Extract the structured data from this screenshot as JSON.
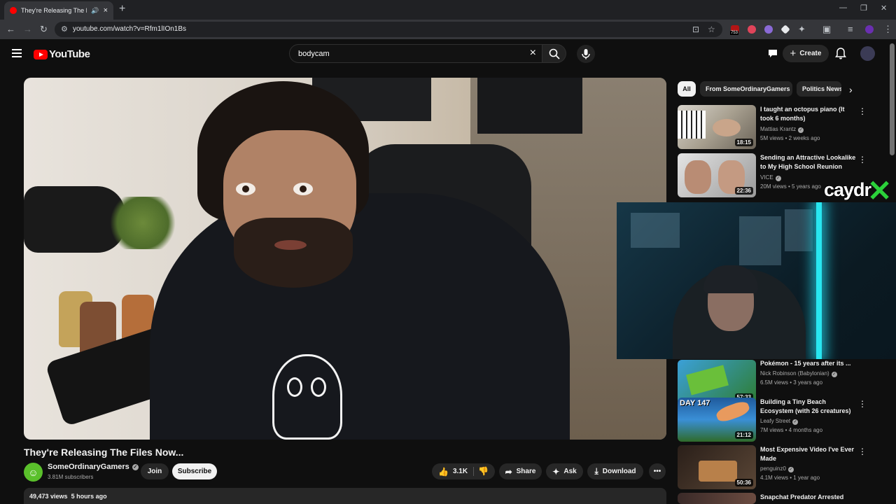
{
  "browser": {
    "tab_title": "They're Releasing The Files",
    "url": "youtube.com/watch?v=Rfm1lIOn1Bs",
    "extension_badge": "753"
  },
  "youtube": {
    "logo_text": "YouTube",
    "search_value": "bodycam",
    "create_label": "Create"
  },
  "video": {
    "title": "They're Releasing The Files Now...",
    "channel": "SomeOrdinaryGamers",
    "subscribers": "3.81M subscribers",
    "join_label": "Join",
    "subscribe_label": "Subscribe",
    "likes": "3.1K",
    "share_label": "Share",
    "ask_label": "Ask",
    "download_label": "Download",
    "views": "49,473 views",
    "age": "5 hours ago"
  },
  "chips": [
    "All",
    "From SomeOrdinaryGamers",
    "Politics News"
  ],
  "recommendations": [
    {
      "title": "I taught an octopus piano (It took 6 months)",
      "channel": "Mattias Krantz",
      "verified": true,
      "meta": "5M views • 2 weeks ago",
      "duration": "18:15"
    },
    {
      "title": "Sending an Attractive Lookalike to My High School Reunion",
      "channel": "VICE",
      "verified": true,
      "meta": "20M views • 5 years ago",
      "duration": "22:36"
    },
    {
      "title": "Pokémon - 15 years after its ...",
      "channel": "Nick Robinson (Babylonian)",
      "verified": true,
      "meta": "6.5M views • 3 years ago",
      "duration": "57:33"
    },
    {
      "title": "Building a Tiny Beach Ecosystem (with 26 creatures)",
      "channel": "Leafy Street",
      "verified": true,
      "meta": "7M views • 4 months ago",
      "duration": "21:12"
    },
    {
      "title": "Most Expensive Video I've Ever Made",
      "channel": "penguinz0",
      "verified": true,
      "meta": "4.1M views • 1 year ago",
      "duration": "50:36"
    },
    {
      "title": "Snapchat Predator Arrested",
      "channel": "",
      "verified": false,
      "meta": "",
      "duration": ""
    }
  ],
  "overlay": {
    "brand_text": "caydr"
  },
  "thumb_text": {
    "day_label": "DAY 147"
  },
  "colors": {
    "youtube_red": "#ff0000",
    "background": "#0f0f0f",
    "verified_gray": "#aaaaaa",
    "overlay_green": "#2bd13a",
    "cam_light": "#28e6f0"
  }
}
